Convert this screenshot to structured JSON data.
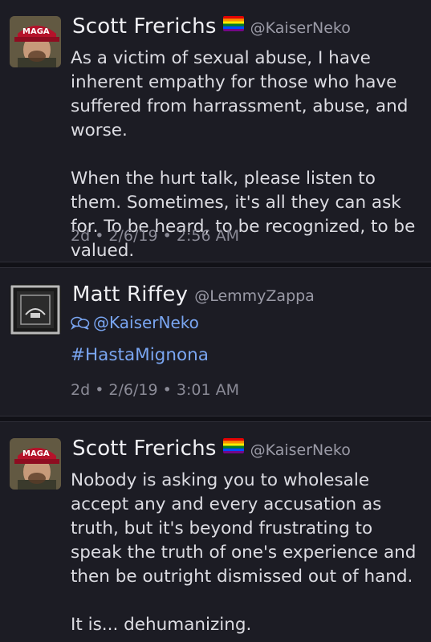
{
  "tweets": [
    {
      "name": "Scott Frerichs",
      "handle": "@KaiserNeko",
      "hat_text": "MAGA",
      "body": "As a victim of sexual abuse, I have inherent empathy for those who have suffered from harrassment, abuse, and worse.\n\nWhen the hurt talk, please listen to them. Sometimes, it's all they can ask for. To be heard, to be recognized, to be valued.",
      "meta": "2d • 2/6/19 • 2:56 AM"
    },
    {
      "name": "Matt Riffey",
      "handle": "@LemmyZappa",
      "reply_to": "@KaiserNeko",
      "hashtag": "#HastaMignona",
      "meta": "2d • 2/6/19 • 3:01 AM"
    },
    {
      "name": "Scott Frerichs",
      "handle": "@KaiserNeko",
      "hat_text": "MAGA",
      "body": "Nobody is asking you to wholesale accept any and every accusation as truth, but it's beyond frustrating to speak the truth of one's experience and then be outright dismissed out of hand.\n\nIt is... dehumanizing."
    }
  ],
  "icons": {
    "flag": "rainbow-flag-icon",
    "reply": "conversation-icon"
  },
  "colors": {
    "background": "#1c1c24",
    "link": "#7aa6f2",
    "meta": "#8b8b97"
  }
}
